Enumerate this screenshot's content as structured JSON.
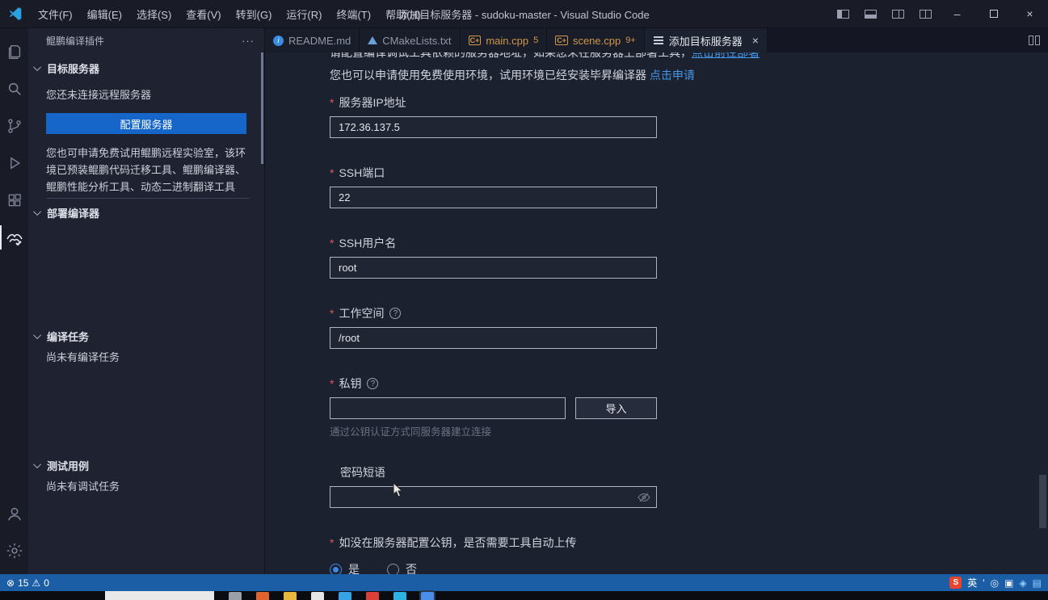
{
  "colors": {
    "accent_blue": "#1566c8",
    "link_blue": "#4596e8",
    "status_bar_blue": "#1c5ea6",
    "required_red": "#e05656",
    "modified_tab_orange": "#cf9846",
    "editor_background": "#1c212f",
    "sidebar_background": "#1f2231"
  },
  "icons": {
    "help_glyph": "?",
    "error_glyph": "⊗",
    "warning_glyph": "⚠",
    "more_actions_glyph": "···",
    "close_glyph": "×",
    "minimize_glyph": "–",
    "readme_glyph": "i",
    "cpp_glyph": "C+"
  },
  "title_bar": {
    "menus": [
      "文件(F)",
      "编辑(E)",
      "选择(S)",
      "查看(V)",
      "转到(G)",
      "运行(R)",
      "终端(T)",
      "帮助(H)"
    ],
    "title": "添加目标服务器 - sudoku-master - Visual Studio Code"
  },
  "sidebar": {
    "title": "鲲鹏编译插件",
    "target_server": {
      "header": "目标服务器",
      "not_connected": "您还未连接远程服务器",
      "configure_button": "配置服务器",
      "promo": "您也可申请免费试用鲲鹏远程实验室，该环境已预装鲲鹏代码迁移工具、鲲鹏编译器、鲲鹏性能分析工具、动态二进制翻译工具"
    },
    "deploy_compiler": {
      "header": "部署编译器"
    },
    "compile_tasks": {
      "header": "编译任务",
      "empty": "尚未有编译任务"
    },
    "test_cases": {
      "header": "测试用例",
      "empty": "尚未有调试任务"
    }
  },
  "tabs": [
    {
      "label": "README.md",
      "badge": ""
    },
    {
      "label": "CMakeLists.txt",
      "badge": ""
    },
    {
      "label": "main.cpp",
      "badge": "5"
    },
    {
      "label": "scene.cpp",
      "badge": "9+"
    },
    {
      "label": "添加目标服务器",
      "badge": ""
    }
  ],
  "form": {
    "intro1_text": "请配置编译调试工具依赖的服务器地址，如果您未在服务器上部署工具，",
    "intro1_link": "点击前往部署",
    "intro2_text": "您也可以申请使用免费使用环境，试用环境已经安装毕昇编译器 ",
    "intro2_link": "点击申请",
    "ip_label": "服务器IP地址",
    "ip_value": "172.36.137.5",
    "port_label": "SSH端口",
    "port_value": "22",
    "user_label": "SSH用户名",
    "user_value": "root",
    "workspace_label": "工作空间",
    "workspace_value": "/root",
    "key_label": "私钥",
    "key_value": "",
    "import_button": "导入",
    "key_hint": "通过公钥认证方式同服务器建立连接",
    "passphrase_label": "密码短语",
    "passphrase_value": "",
    "upload_label": "如没在服务器配置公钥，是否需要工具自动上传",
    "upload_yes": "是",
    "upload_no": "否",
    "upload_selected": "是"
  },
  "status_bar": {
    "errors": "15",
    "warnings": "0",
    "ime_logo": "S",
    "ime_mode": "英",
    "ime_sep": "'"
  },
  "taskbar": {
    "icons": [
      {
        "name": "taskbar-app-1",
        "color": "#9aa0a8"
      },
      {
        "name": "taskbar-app-2",
        "color": "#e0622e"
      },
      {
        "name": "taskbar-app-3",
        "color": "#e8b83a"
      },
      {
        "name": "taskbar-app-4",
        "color": "#e6e6e6"
      },
      {
        "name": "taskbar-app-5",
        "color": "#35a3e6"
      },
      {
        "name": "taskbar-app-6",
        "color": "#d84038"
      },
      {
        "name": "taskbar-app-7",
        "color": "#2bb3e6"
      },
      {
        "name": "taskbar-app-8",
        "color": "#4a8ce8"
      }
    ]
  }
}
